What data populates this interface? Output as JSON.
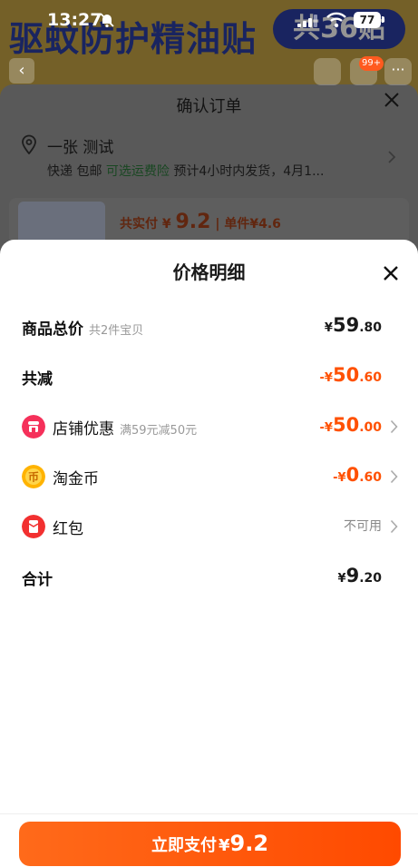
{
  "status_bar": {
    "time": "13:27",
    "battery": "77"
  },
  "background": {
    "banner_title": "驱蚊防护精油贴",
    "banner_pill": "共36贴",
    "cart_badge": "99+",
    "order_sheet": {
      "title": "确认订单",
      "recipient": "一张 测试",
      "ship_prefix": "快递 包邮 ",
      "ship_highlight": "可选运费险",
      "ship_suffix": " 预计4小时内发货，4月1...",
      "price_prefix": "共实付 ¥ ",
      "price_amount": "9.2",
      "price_unit": " | 单件¥4.6"
    }
  },
  "price_detail": {
    "title": "价格明细",
    "rows": [
      {
        "label": "商品总价",
        "sub": "共2件宝贝",
        "currency": "¥",
        "int": "59",
        "dec": ".80"
      },
      {
        "label": "共减",
        "currency": "-¥",
        "int": "50",
        "dec": ".60"
      },
      {
        "label": "店铺优惠",
        "sub": "满59元减50元",
        "currency": "-¥",
        "int": "50",
        "dec": ".00",
        "icon": "store-icon"
      },
      {
        "label": "淘金币",
        "currency": "-¥",
        "int": "0",
        "dec": ".60",
        "icon": "coin-icon"
      },
      {
        "label": "红包",
        "value_text": "不可用",
        "icon": "red-envelope-icon"
      },
      {
        "label": "合计",
        "currency": "¥",
        "int": "9",
        "dec": ".20"
      }
    ],
    "pay_button": {
      "label": "立即支付",
      "currency": "¥",
      "amount": "9.2"
    }
  },
  "colors": {
    "accent": "#ff5000",
    "sheet_bg": "#ffffff",
    "backdrop": "rgba(0,0,0,0.42)"
  }
}
